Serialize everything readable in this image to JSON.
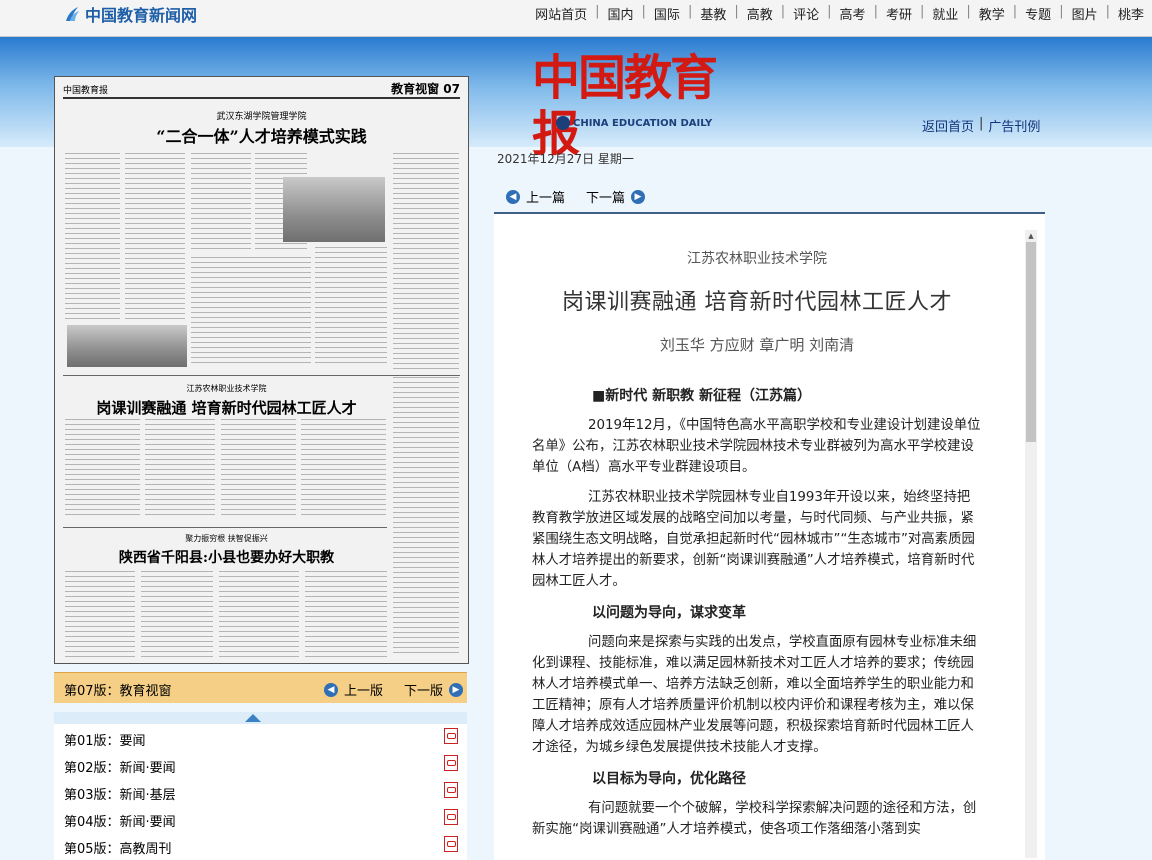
{
  "site": {
    "name": "中国教育新闻网",
    "nav": [
      "网站首页",
      "国内",
      "国际",
      "基教",
      "高教",
      "评论",
      "高考",
      "考研",
      "就业",
      "教学",
      "专题",
      "图片",
      "桃李"
    ]
  },
  "header": {
    "logo_text": "中国教育报",
    "logo_en": "CHINA EDUCATION DAILY",
    "links": [
      "返回首页",
      "广告刊例"
    ],
    "date": "2021年12月27日  星期一"
  },
  "article_nav": {
    "prev": "上一篇",
    "next": "下一篇"
  },
  "article": {
    "school": "江苏农林职业技术学院",
    "title": "岗课训赛融通  培育新时代园林工匠人才",
    "authors": "刘玉华  方应财  章广明  刘南清",
    "column": "■新时代  新职教  新征程（江苏篇）",
    "p1": "2019年12月，《中国特色高水平高职学校和专业建设计划建设单位名单》公布，江苏农林职业技术学院园林技术专业群被列为高水平学校建设单位（A档）高水平专业群建设项目。",
    "p2": "江苏农林职业技术学院园林专业自1993年开设以来，始终坚持把教育教学放进区域发展的战略空间加以考量，与时代同频、与产业共振，紧紧围绕生态文明战略，自觉承担起新时代“园林城市”“生态城市”对高素质园林人才培养提出的新要求，创新“岗课训赛融通”人才培养模式，培育新时代园林工匠人才。",
    "h1": "以问题为导向，谋求变革",
    "p3": "问题向来是探索与实践的出发点，学校直面原有园林专业标准未细化到课程、技能标准，难以满足园林新技术对工匠人才培养的要求；传统园林人才培养模式单一、培养方法缺乏创新，难以全面培养学生的职业能力和工匠精神；原有人才培养质量评价机制以校内评价和课程考核为主，难以保障人才培养成效适应园林产业发展等问题，积极探索培育新时代园林工匠人才途径，为城乡绿色发展提供技术技能人才支撑。",
    "h2": "以目标为导向，优化路径",
    "p4": "有问题就要一个个破解，学校科学探索解决问题的途径和方法，创新实施“岗课训赛融通”人才培养模式，使各项工作落细落小落到实"
  },
  "paper": {
    "header_left": "中国教育报",
    "header_right": "教育视窗 07",
    "headline1_sub": "武汉东湖学院管理学院",
    "headline1": "“二合一体”人才培养模式实践",
    "headline2_sub": "江苏农林职业技术学院",
    "headline2": "岗课训赛融通    培育新时代园林工匠人才",
    "headline3_sub": "聚力振穷根  扶智促振兴",
    "headline3": "陕西省千阳县:小县也要办好大职教"
  },
  "paper_footer": {
    "version": "第07版：教育视窗",
    "prev": "上一版",
    "next": "下一版"
  },
  "paper_list": [
    {
      "label": "第01版：要闻"
    },
    {
      "label": "第02版：新闻·要闻"
    },
    {
      "label": "第03版：新闻·基层"
    },
    {
      "label": "第04版：新闻·要闻"
    },
    {
      "label": "第05版：高教周刊"
    }
  ]
}
